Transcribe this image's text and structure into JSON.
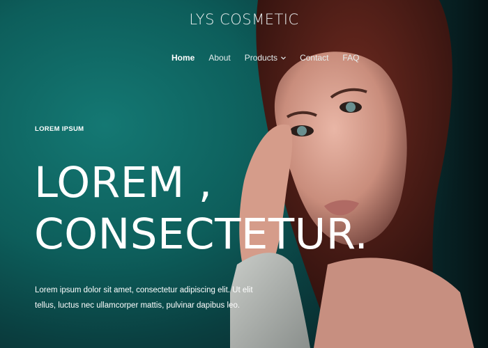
{
  "header": {
    "brand": "LYS COSMETIC",
    "nav": [
      {
        "label": "Home",
        "active": true
      },
      {
        "label": "About"
      },
      {
        "label": "Products",
        "has_dropdown": true
      },
      {
        "label": "Contact"
      },
      {
        "label": "FAQ"
      }
    ]
  },
  "hero": {
    "eyebrow": "LOREM IPSUM",
    "headline_line1": "LOREM ,",
    "headline_line2": "CONSECTETUR.",
    "body": "Lorem ipsum dolor sit amet, consectetur adipiscing elit. Ut elit tellus, luctus nec ullamcorper mattis, pulvinar dapibus leo."
  },
  "icons": {
    "products_dropdown": "chevron-down-icon"
  },
  "colors": {
    "background_teal": "#0d5e5b",
    "text": "#ffffff"
  }
}
